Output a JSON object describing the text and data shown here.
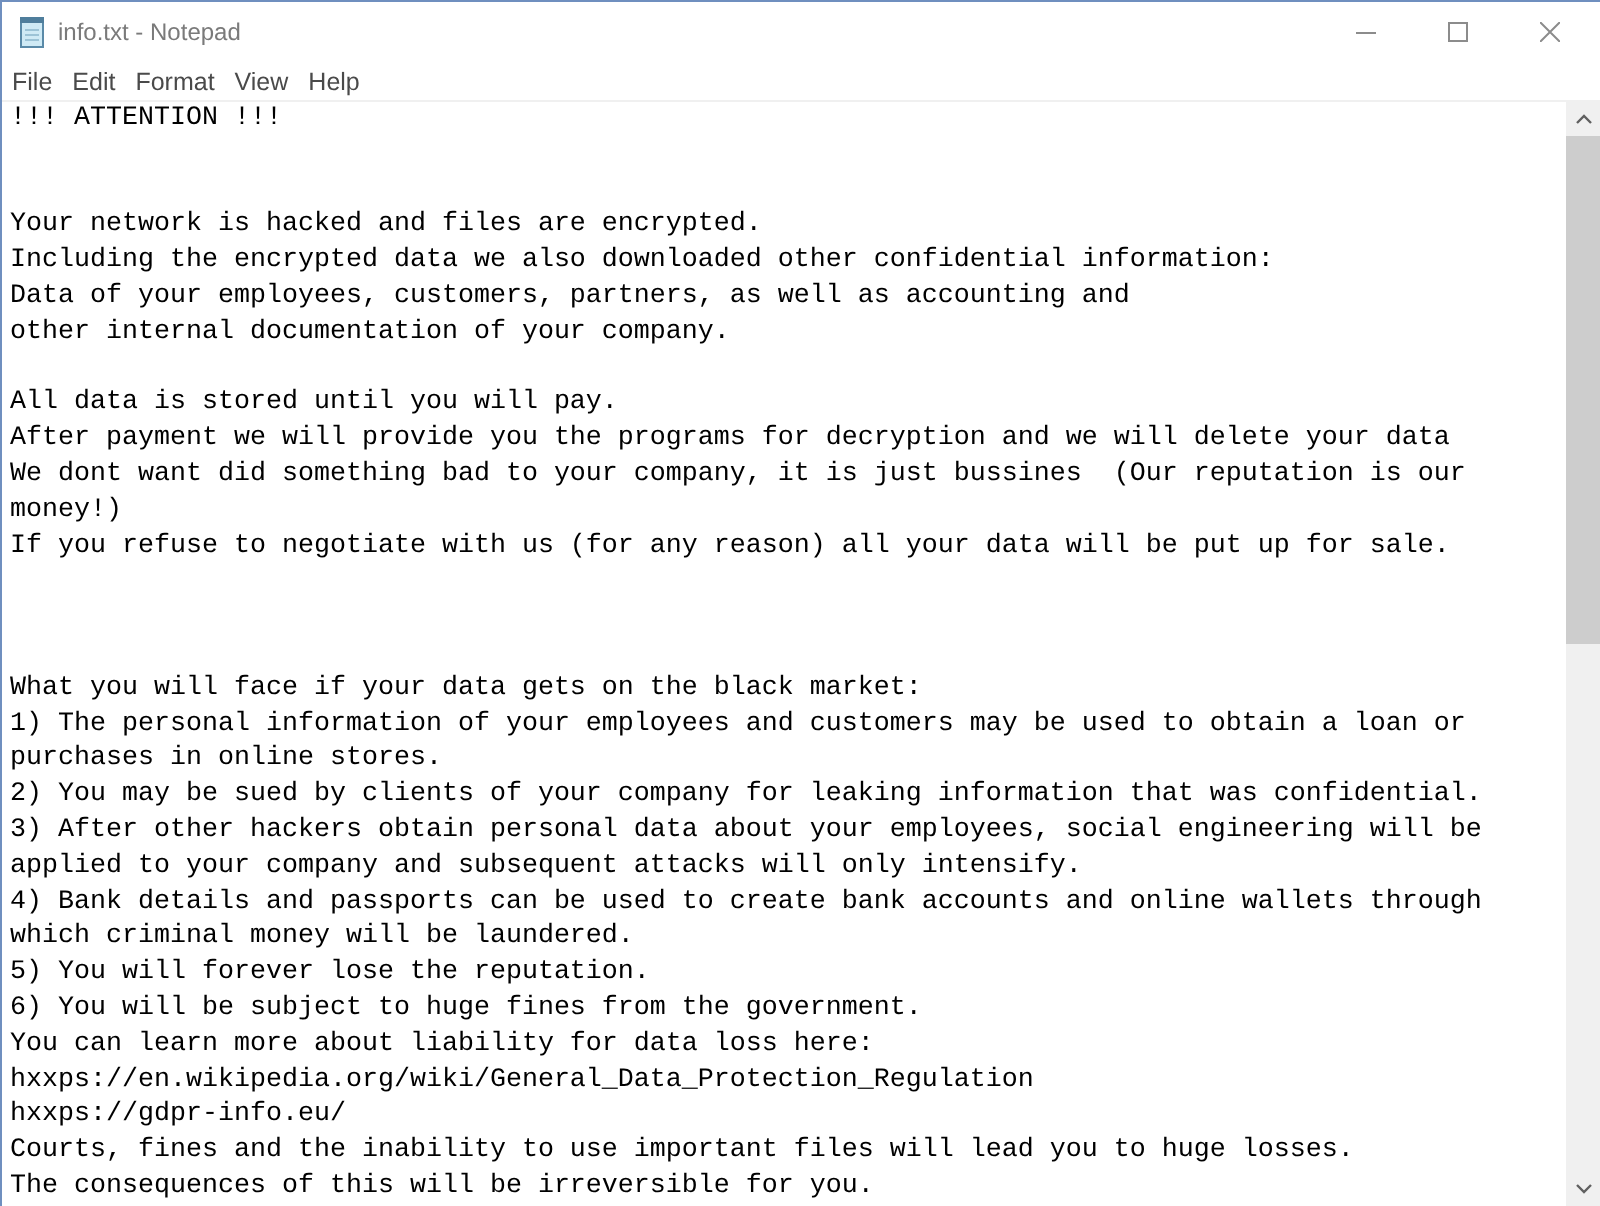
{
  "window": {
    "title": "info.txt - Notepad"
  },
  "menu_bar": [
    "File",
    "Edit",
    "Format",
    "View",
    "Help"
  ],
  "document": {
    "lines": [
      {
        "kind": "text",
        "text": "!!! ATTENTION !!!"
      },
      {
        "kind": "blank"
      },
      {
        "kind": "blank"
      },
      {
        "kind": "text",
        "text": "Your network is hacked and files are encrypted."
      },
      {
        "kind": "text",
        "text": "Including the encrypted data we also downloaded other confidential information:"
      },
      {
        "kind": "text",
        "text": "Data of your employees, customers, partners, as well as accounting and"
      },
      {
        "kind": "text",
        "text": "other internal documentation of your company."
      },
      {
        "kind": "blank"
      },
      {
        "kind": "text",
        "text": "All data is stored until you will pay."
      },
      {
        "kind": "text",
        "text": "After payment we will provide you the programs for decryption and we will delete your data"
      },
      {
        "kind": "text",
        "text": "We dont want did something bad to your company, it is just bussines  (Our reputation is our money!)"
      },
      {
        "kind": "text",
        "text": "If you refuse to negotiate with us (for any reason) all your data will be put up for sale."
      },
      {
        "kind": "blank"
      },
      {
        "kind": "blank"
      },
      {
        "kind": "blank"
      },
      {
        "kind": "text",
        "text": "What you will face if your data gets on the black market:"
      },
      {
        "kind": "text",
        "text": "1) The personal information of your employees and customers may be used to obtain a loan or purchases in online stores."
      },
      {
        "kind": "text",
        "text": "2) You may be sued by clients of your company for leaking information that was confidential."
      },
      {
        "kind": "text",
        "text": "3) After other hackers obtain personal data about your employees, social engineering will be applied to your company and subsequent attacks will only intensify."
      },
      {
        "kind": "text",
        "text": "4) Bank details and passports can be used to create bank accounts and online wallets through which criminal money will be laundered."
      },
      {
        "kind": "text",
        "text": "5) You will forever lose the reputation."
      },
      {
        "kind": "text",
        "text": "6) You will be subject to huge fines from the government."
      },
      {
        "kind": "text",
        "text": "You can learn more about liability for data loss here:"
      },
      {
        "kind": "text",
        "text": "hxxps://en.wikipedia.org/wiki/General_Data_Protection_Regulation"
      },
      {
        "kind": "text",
        "text": "hxxps://gdpr-info.eu/"
      },
      {
        "kind": "text",
        "text": "Courts, fines and the inability to use important files will lead you to huge losses."
      },
      {
        "kind": "text",
        "text": "The consequences of this will be irreversible for you."
      }
    ]
  }
}
